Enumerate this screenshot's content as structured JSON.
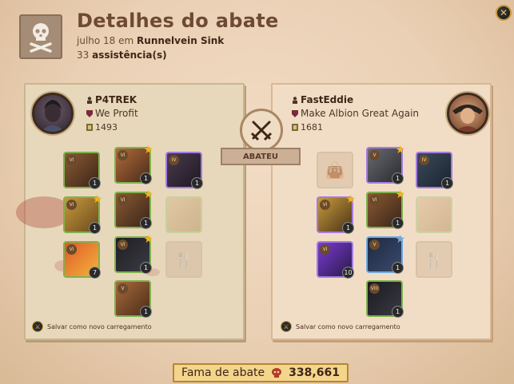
{
  "header": {
    "title": "Detalhes do abate",
    "date": "julho 18 em",
    "location": "Runnelvein Sink",
    "assists_count": "33",
    "assists_label": "assistência(s)"
  },
  "close_button": {
    "label": "✕"
  },
  "killer": {
    "name": "P4TREK",
    "guild": "We Profit",
    "item_power": "1493",
    "save_label": "Salvar como novo carregamento",
    "slots": [
      {
        "item": "bag",
        "quality": "1",
        "tier": "VI",
        "star": false,
        "color": "#7fb24e",
        "present": true
      },
      {
        "item": "helmet",
        "quality": "1",
        "tier": "VI",
        "star": true,
        "color": "#7fb24e",
        "present": true
      },
      {
        "item": "cape",
        "quality": "1",
        "tier": "IV",
        "star": false,
        "color": "#a47be2",
        "present": true
      },
      {
        "item": "weapon",
        "quality": "1",
        "tier": "VI",
        "star": true,
        "color": "#7fb24e",
        "present": true
      },
      {
        "item": "armor",
        "quality": "1",
        "tier": "VI",
        "star": true,
        "color": "#7fb24e",
        "present": true
      },
      {
        "item": "offhand",
        "quality": "",
        "tier": "",
        "star": false,
        "color": "#7fb24e",
        "present": true,
        "faded": true
      },
      {
        "item": "potion",
        "quality": "7",
        "tier": "VI",
        "star": false,
        "color": "#7fb24e",
        "present": true
      },
      {
        "item": "shoes",
        "quality": "1",
        "tier": "VI",
        "star": true,
        "color": "#7fb24e",
        "present": true
      },
      {
        "item": "food",
        "quality": "",
        "tier": "",
        "star": false,
        "present": false
      },
      {
        "item": "mount",
        "quality": "1",
        "tier": "V",
        "star": false,
        "color": "#7fb24e",
        "present": true
      }
    ]
  },
  "victim": {
    "name": "FastEddie",
    "guild": "Make Albion Great Again",
    "item_power": "1681",
    "save_label": "Salvar como novo carregamento",
    "slots": [
      {
        "item": "bag",
        "quality": "",
        "tier": "",
        "star": false,
        "present": false
      },
      {
        "item": "helmet",
        "quality": "1",
        "tier": "V",
        "star": true,
        "color": "#a47be2",
        "present": true
      },
      {
        "item": "cape",
        "quality": "1",
        "tier": "IV",
        "star": false,
        "color": "#a47be2",
        "present": true
      },
      {
        "item": "weapon",
        "quality": "1",
        "tier": "VI",
        "star": true,
        "color": "#a47be2",
        "present": true
      },
      {
        "item": "armor",
        "quality": "1",
        "tier": "VI",
        "star": true,
        "color": "#7fb24e",
        "present": true
      },
      {
        "item": "offhand",
        "quality": "",
        "tier": "",
        "star": false,
        "present": true,
        "faded": true,
        "color": "#7fb24e"
      },
      {
        "item": "potion",
        "quality": "10",
        "tier": "VI",
        "star": false,
        "color": "#a47be2",
        "present": true
      },
      {
        "item": "shoes",
        "quality": "1",
        "tier": "V",
        "star": true,
        "color": "#6fa8e0",
        "present": true
      },
      {
        "item": "food",
        "quality": "",
        "tier": "",
        "star": false,
        "present": false
      },
      {
        "item": "mount",
        "quality": "1",
        "tier": "VIII",
        "star": false,
        "color": "#7fb24e",
        "present": true
      }
    ]
  },
  "center": {
    "killed_label": "ABATEU"
  },
  "fame": {
    "label": "Fama de abate",
    "value": "338,661"
  }
}
